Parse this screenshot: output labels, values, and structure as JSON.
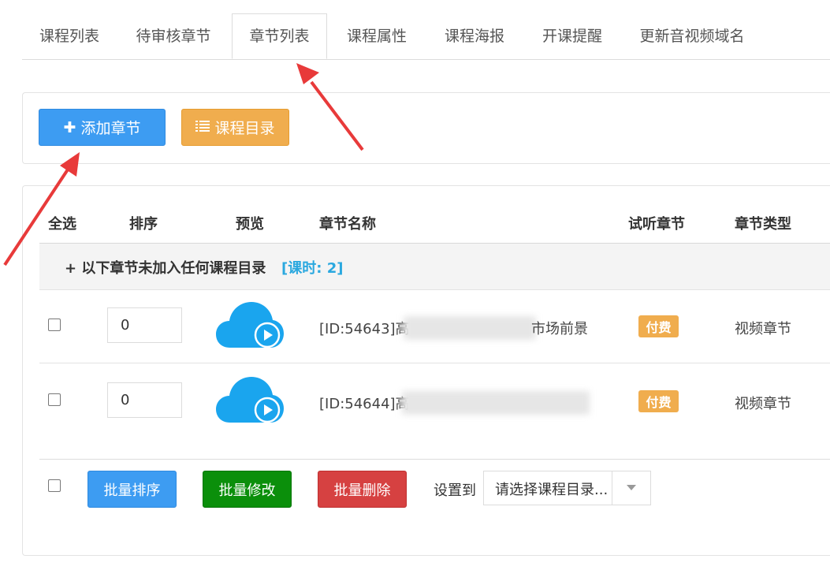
{
  "tabs": [
    {
      "label": "课程列表"
    },
    {
      "label": "待审核章节"
    },
    {
      "label": "章节列表"
    },
    {
      "label": "课程属性"
    },
    {
      "label": "课程海报"
    },
    {
      "label": "开课提醒"
    },
    {
      "label": "更新音视频域名"
    }
  ],
  "toolbar": {
    "add_label": "添加章节",
    "catalog_label": "课程目录"
  },
  "table": {
    "headers": {
      "select_all": "全选",
      "sort": "排序",
      "preview": "预览",
      "name": "章节名称",
      "trial": "试听章节",
      "type": "章节类型"
    },
    "group": {
      "title": "+ 以下章节未加入任何课程目录",
      "badge": "[课时: 2]"
    },
    "rows": [
      {
        "sort": "0",
        "name_prefix": "[ID:54643]高",
        "name_suffix": "市场前景",
        "trial": "付费",
        "type": "视频章节"
      },
      {
        "sort": "0",
        "name_prefix": "[ID:54644]高",
        "name_suffix": "",
        "trial": "付费",
        "type": "视频章节"
      }
    ]
  },
  "batch": {
    "sort_label": "批量排序",
    "edit_label": "批量修改",
    "delete_label": "批量删除",
    "set_to_label": "设置到",
    "select_value": "请选择课程目录..."
  },
  "colors": {
    "primary": "#3d9cf2",
    "warning": "#f0ad4e",
    "success": "#0b8f0b",
    "danger": "#d64141",
    "annotation_arrow": "#e83a3a",
    "cloud": "#1aa5ee"
  },
  "icons": {
    "add": "plus-icon",
    "catalog": "list-icon",
    "preview": "cloud-play-icon",
    "dropdown": "caret-down-icon"
  }
}
